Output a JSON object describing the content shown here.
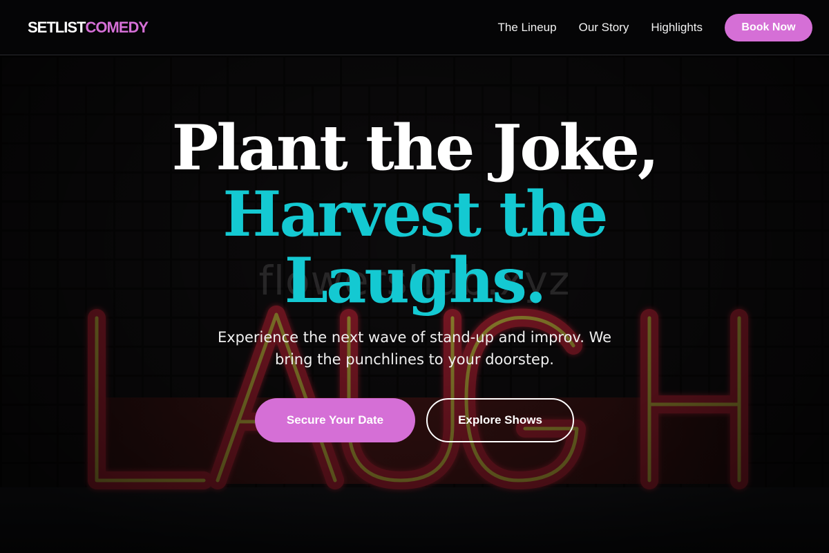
{
  "nav": {
    "logo_part1": "SETLIST",
    "logo_part2": "COMEDY",
    "links": [
      {
        "label": "The Lineup"
      },
      {
        "label": "Our Story"
      },
      {
        "label": "Highlights"
      }
    ],
    "cta_label": "Book Now"
  },
  "hero": {
    "headline_line1": "Plant the Joke,",
    "headline_line2": "Harvest the",
    "headline_line3": "Laughs.",
    "subtitle": "Experience the next wave of stand-up and improv. We bring the punchlines to your doorstep.",
    "primary_button": "Secure Your Date",
    "secondary_button": "Explore Shows",
    "background_sign_text": "LAUGH",
    "watermark": "flowershub.xyz"
  },
  "colors": {
    "accent_pink": "#d56fd6",
    "accent_cyan": "#14c9d2",
    "nav_bg": "#050506",
    "neon_red": "#e23a4a",
    "neon_yellow": "#e8d24a"
  }
}
